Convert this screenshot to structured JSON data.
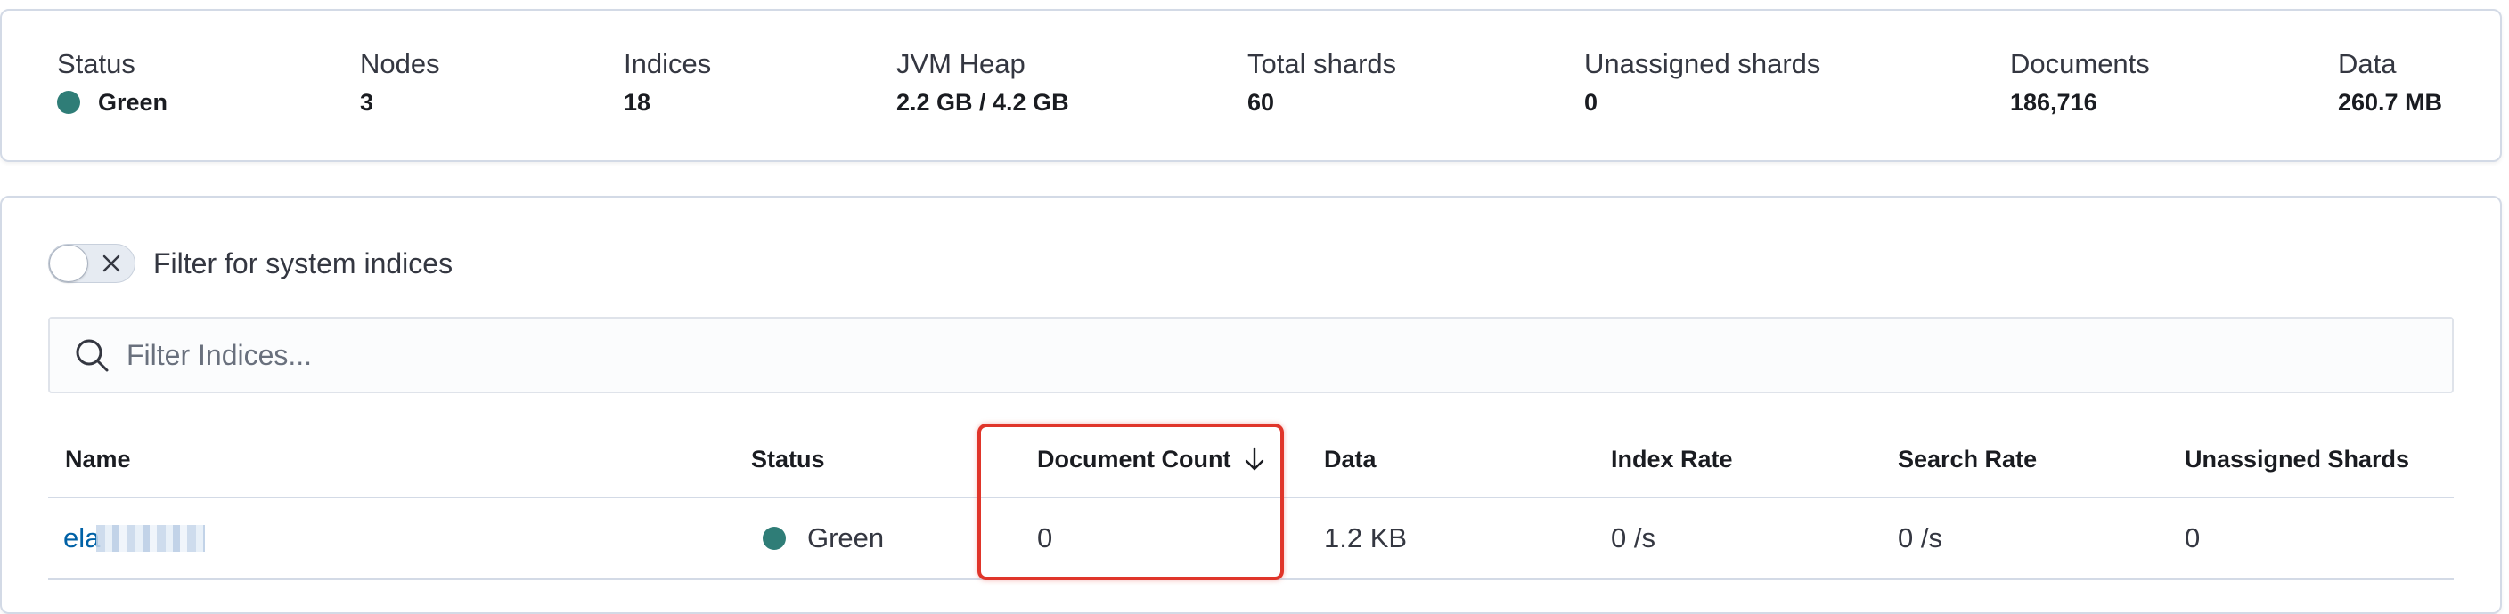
{
  "cluster_summary": {
    "status": {
      "label": "Status",
      "value": "Green",
      "color": "#2f7d77"
    },
    "nodes": {
      "label": "Nodes",
      "value": "3"
    },
    "indices": {
      "label": "Indices",
      "value": "18"
    },
    "jvm_heap": {
      "label": "JVM Heap",
      "value": "2.2 GB / 4.2 GB"
    },
    "total_shards": {
      "label": "Total shards",
      "value": "60"
    },
    "unassigned_shards": {
      "label": "Unassigned shards",
      "value": "0"
    },
    "documents": {
      "label": "Documents",
      "value": "186,716"
    },
    "data": {
      "label": "Data",
      "value": "260.7 MB"
    }
  },
  "filters": {
    "system_indices_toggle_label": "Filter for system indices",
    "system_indices_toggle_on": false,
    "search_placeholder": "Filter Indices...",
    "search_value": ""
  },
  "table": {
    "columns": {
      "name": "Name",
      "status": "Status",
      "document_count": "Document Count",
      "data": "Data",
      "index_rate": "Index Rate",
      "search_rate": "Search Rate",
      "unassigned_shards": "Unassigned Shards"
    },
    "sort": {
      "column": "document_count",
      "direction": "descending"
    },
    "rows": [
      {
        "name": "ela",
        "name_redacted": true,
        "status": "Green",
        "document_count": "0",
        "data": "1.2 KB",
        "index_rate": "0 /s",
        "search_rate": "0 /s",
        "unassigned_shards": "0"
      }
    ]
  },
  "colors": {
    "status_green": "#2f7d77",
    "link": "#0061a6",
    "highlight_box": "#e0352a",
    "border": "#d3dae6"
  },
  "icons": {
    "status": "status-dot",
    "toggle_off": "close-icon",
    "search": "search-icon",
    "sort": "arrow-down-icon"
  }
}
